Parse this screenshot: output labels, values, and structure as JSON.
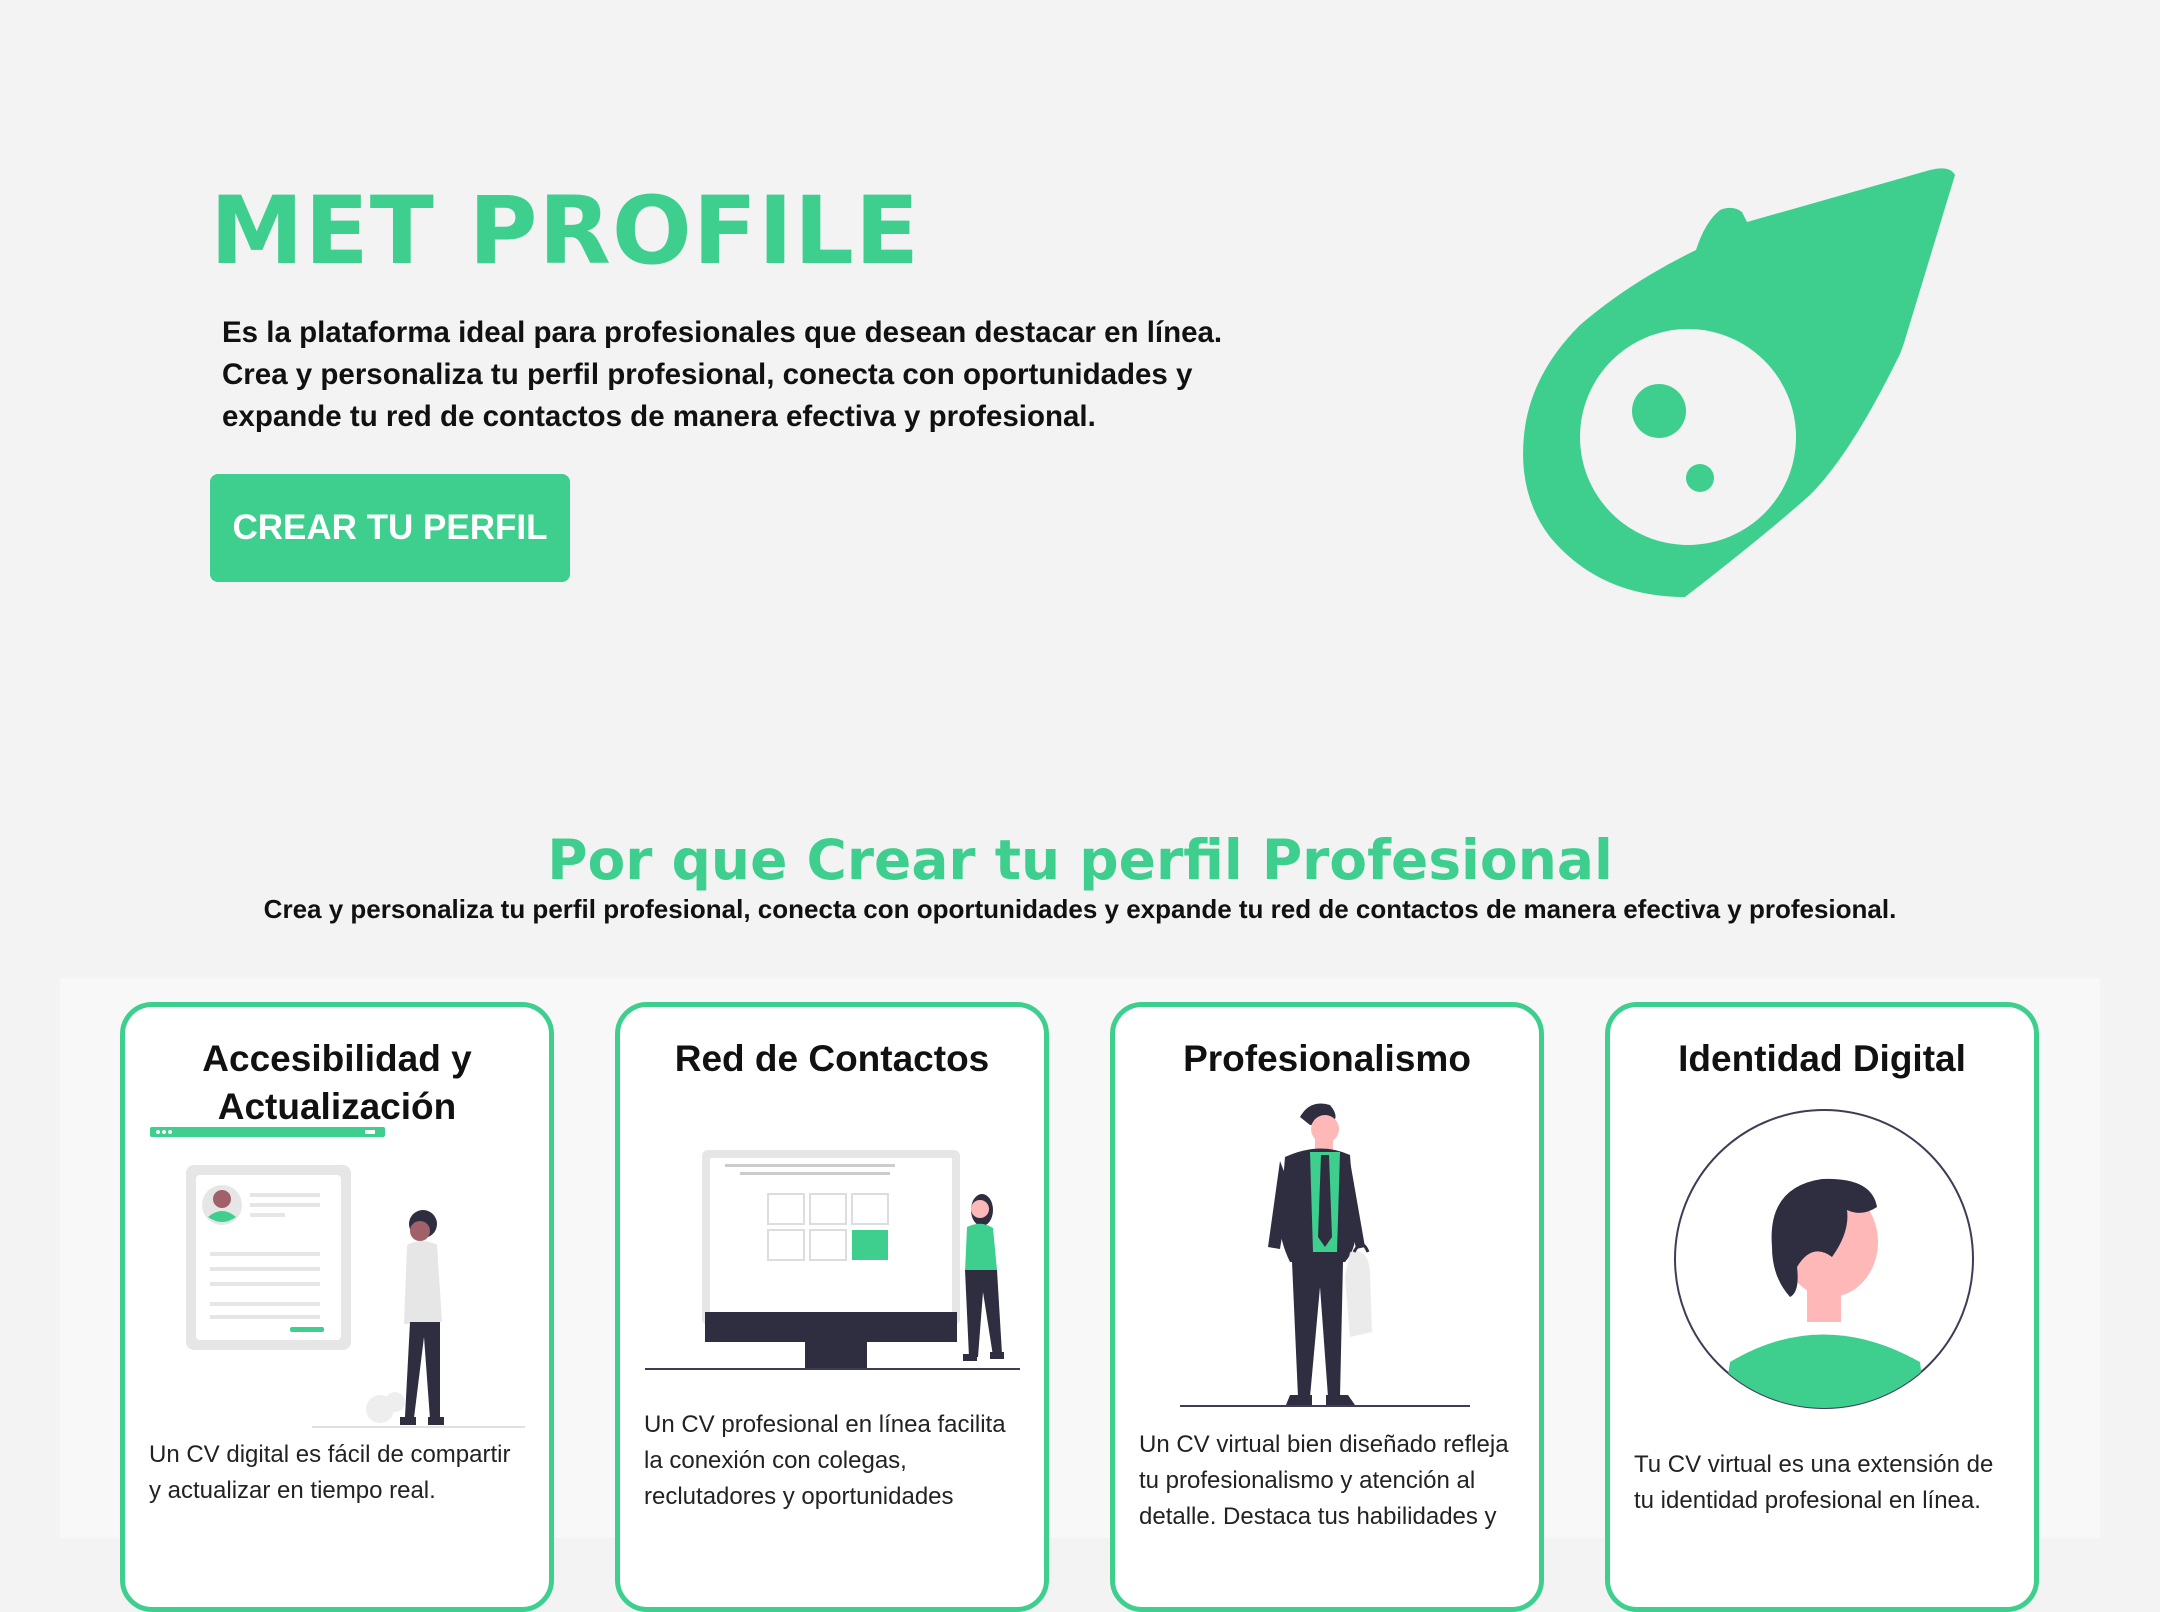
{
  "hero": {
    "title": "MET PROFILE",
    "description": "Es la plataforma ideal para profesionales que desean destacar en línea. Crea y personaliza tu perfil profesional, conecta con oportunidades y expande tu red de contactos de manera efectiva y profesional.",
    "cta_label": "CREAR TU PERFIL"
  },
  "why": {
    "title": "Por que Crear tu perfil Profesional",
    "subtitle": "Crea y personaliza tu perfil profesional, conecta con oportunidades y expande tu red de contactos de manera efectiva y profesional."
  },
  "cards": [
    {
      "title": "Accesibilidad y Actualización",
      "text": "Un CV digital es fácil de compartir y actualizar en tiempo real.",
      "icon": "cv-document-illustration"
    },
    {
      "title": "Red de Contactos",
      "text": "Un CV profesional en línea facilita la conexión con colegas, reclutadores y oportunidades",
      "icon": "monitor-illustration"
    },
    {
      "title": "Profesionalismo",
      "text": "Un CV virtual bien diseñado refleja tu profesionalismo y atención al detalle. Destaca tus habilidades y",
      "icon": "businessman-illustration"
    },
    {
      "title": "Identidad Digital",
      "text": "Tu CV virtual es una extensión de tu identidad profesional en línea.",
      "icon": "avatar-illustration"
    }
  ],
  "colors": {
    "accent": "#3ecf8e",
    "background": "#f4f3f4",
    "dark": "#2f2e41",
    "skin": "#ffb8b8"
  }
}
